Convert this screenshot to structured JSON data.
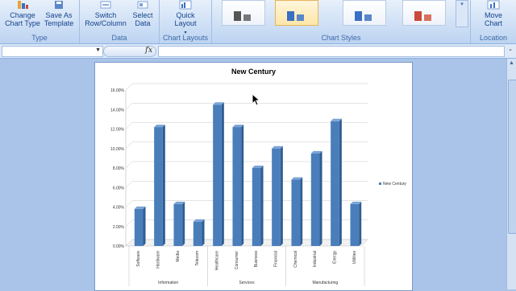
{
  "ribbon": {
    "type_group": {
      "label": "Type",
      "change_chart_type": "Change Chart Type",
      "save_as_template": "Save As Template"
    },
    "data_group": {
      "label": "Data",
      "switch_row_column": "Switch Row/Column",
      "select_data": "Select Data"
    },
    "layouts_group": {
      "label": "Chart Layouts",
      "quick_layout": "Quick Layout"
    },
    "styles_group": {
      "label": "Chart Styles"
    },
    "location_group": {
      "label": "Location",
      "move_chart": "Move Chart"
    }
  },
  "formula_bar": {
    "fx": "fx",
    "value": ""
  },
  "chart_data": {
    "type": "bar",
    "title": "New Century",
    "categories": [
      "Software",
      "Hardware",
      "Media",
      "Telecom",
      "Healthcare",
      "Consumer",
      "Business",
      "Financial",
      "Chemical",
      "Industrial",
      "Energy",
      "Utilities"
    ],
    "groups": [
      {
        "name": "Information",
        "categories": [
          "Software",
          "Hardware",
          "Media",
          "Telecom"
        ]
      },
      {
        "name": "Services",
        "categories": [
          "Healthcare",
          "Consumer",
          "Business",
          "Financial"
        ]
      },
      {
        "name": "Manufacturing",
        "categories": [
          "Chemical",
          "Industrial",
          "Energy",
          "Utilities"
        ]
      }
    ],
    "series": [
      {
        "name": "New Century",
        "values": [
          3.8,
          12.2,
          4.3,
          2.5,
          14.5,
          12.2,
          8.0,
          10.0,
          6.8,
          9.5,
          12.8,
          4.3
        ]
      }
    ],
    "ylim": [
      0,
      16
    ],
    "yticks": [
      "0.00%",
      "2.00%",
      "4.00%",
      "6.00%",
      "8.00%",
      "10.00%",
      "12.00%",
      "14.00%",
      "16.00%"
    ],
    "grid": true,
    "legend": "right",
    "bar_color": "#4a7ebb"
  }
}
